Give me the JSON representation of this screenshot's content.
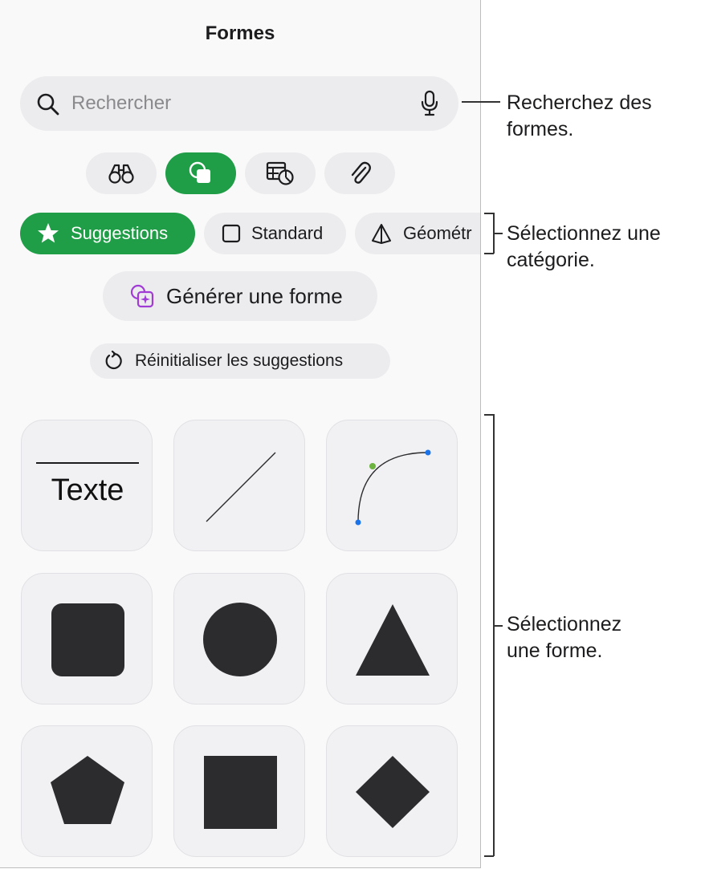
{
  "panel": {
    "title": "Formes",
    "search": {
      "placeholder": "Rechercher",
      "icon": "magnifier-icon",
      "voice_icon": "microphone-icon"
    },
    "modes": [
      {
        "icon": "binoculars-icon",
        "selected": false
      },
      {
        "icon": "shapes-icon",
        "selected": true
      },
      {
        "icon": "table-chart-icon",
        "selected": false
      },
      {
        "icon": "paperclip-icon",
        "selected": false
      }
    ],
    "categories": [
      {
        "label": "Suggestions",
        "icon": "star-icon",
        "selected": true
      },
      {
        "label": "Standard",
        "icon": "square-outline-icon",
        "selected": false
      },
      {
        "label": "Géométr",
        "icon": "pyramid-icon",
        "selected": false
      }
    ],
    "generate_button": {
      "label": "Générer une forme",
      "icon": "sparkle-shapes-icon"
    },
    "reset_button": {
      "label": "Réinitialiser les suggestions",
      "icon": "reset-arrow-icon"
    },
    "shapes": [
      {
        "kind": "text-box",
        "label": "Texte"
      },
      {
        "kind": "line"
      },
      {
        "kind": "curve"
      },
      {
        "kind": "rounded-square"
      },
      {
        "kind": "circle"
      },
      {
        "kind": "triangle"
      },
      {
        "kind": "pentagon"
      },
      {
        "kind": "square"
      },
      {
        "kind": "diamond"
      }
    ]
  },
  "callouts": {
    "search": [
      "Recherchez des",
      "formes."
    ],
    "category": [
      "Sélectionnez une",
      "catégorie."
    ],
    "shape": [
      "Sélectionnez",
      "une forme."
    ]
  },
  "colors": {
    "accent_green": "#1f9d47",
    "control_bg": "#ececee",
    "tile_bg": "#f1f1f4",
    "shape_fill": "#2c2c2e",
    "generate_icon": "#a13bd6",
    "handle_green": "#6db33f",
    "handle_blue": "#1a73e8"
  }
}
